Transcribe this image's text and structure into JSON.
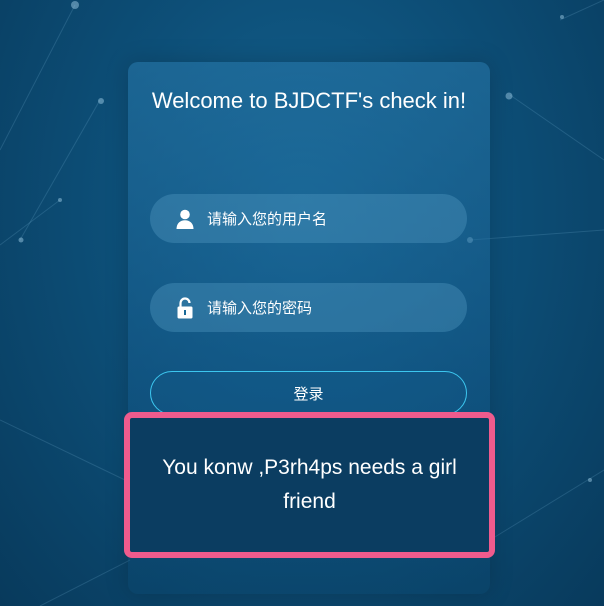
{
  "login": {
    "title": "Welcome to BJDCTF's check in!",
    "username_placeholder": "请输入您的用户名",
    "password_placeholder": "请输入您的密码",
    "login_button": "登录",
    "username_icon": "user-icon",
    "password_icon": "lock-icon"
  },
  "message": {
    "text": "You konw ,P3rh4ps needs a girl friend",
    "highlight_color": "#ef5b8d"
  },
  "colors": {
    "background": "#0d4f78",
    "button_border": "#3cc6ef"
  }
}
